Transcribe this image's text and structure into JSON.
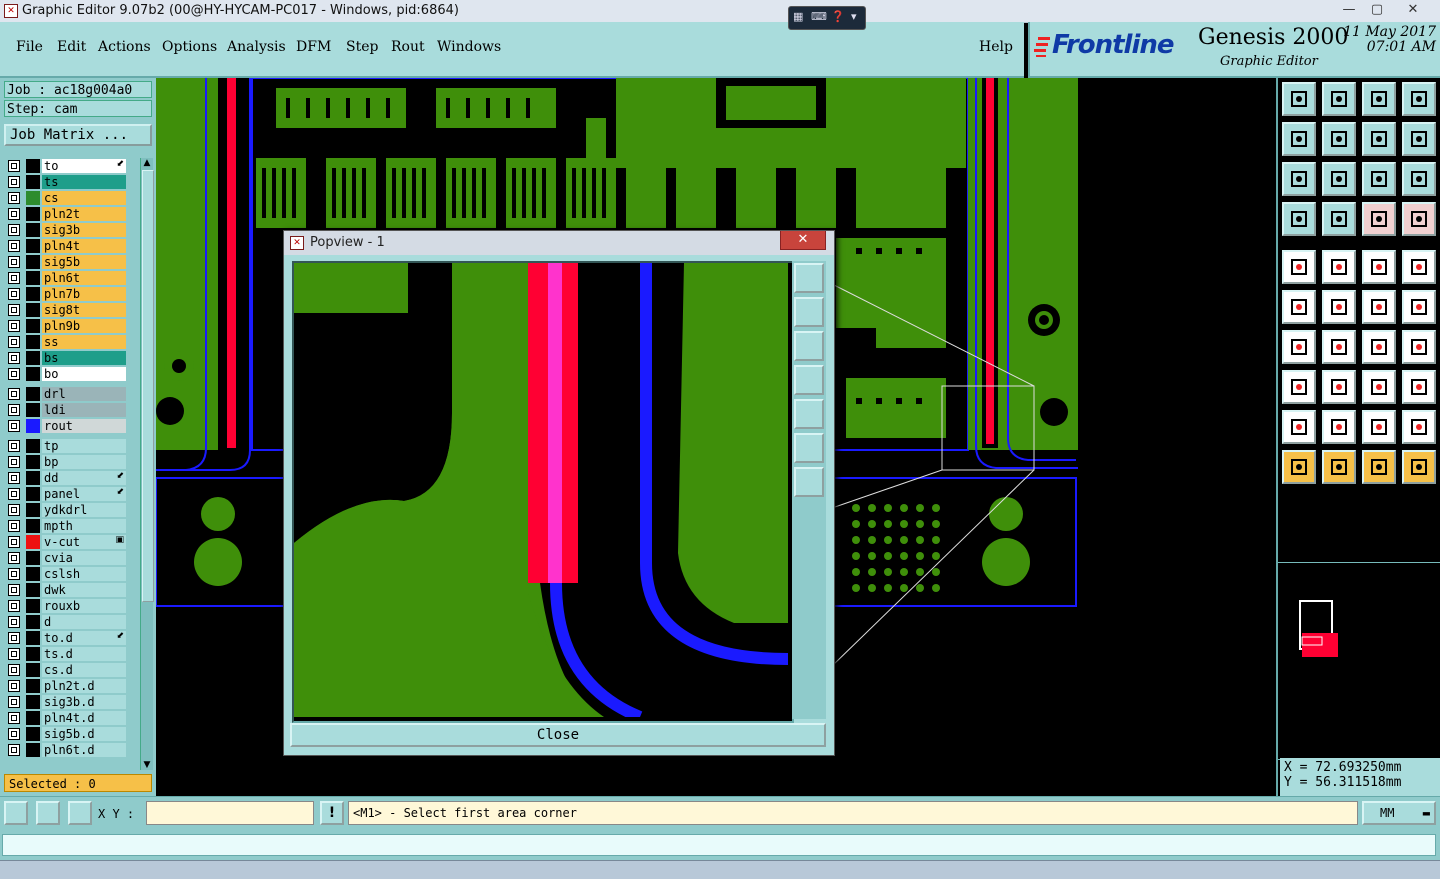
{
  "window": {
    "title": "Graphic Editor 9.07b2 (00@HY-HYCAM-PC017 - Windows, pid:6864)",
    "minimize": "—",
    "maximize": "▢",
    "close": "✕"
  },
  "menu": {
    "items": [
      "File",
      "Edit",
      "Actions",
      "Options",
      "Analysis",
      "DFM",
      "Step",
      "Rout",
      "Windows"
    ],
    "help": "Help"
  },
  "logo": {
    "brand": "Frontline",
    "product": "Genesis 2000",
    "subtitle": "Graphic Editor",
    "date": "11 May 2017",
    "time": "07:01 AM"
  },
  "job": {
    "job_label": "Job : ac18g004a0",
    "step_label": "Step: cam",
    "matrix_button": "Job Matrix ..."
  },
  "layers": [
    {
      "name": "to",
      "bg": "#ffffff",
      "swatch": "#000000",
      "mark": "⬋"
    },
    {
      "name": "ts",
      "bg": "#1e9e8a",
      "swatch": "#000000",
      "mark": ""
    },
    {
      "name": "cs",
      "bg": "#f6c048",
      "swatch": "#2d8c2d",
      "mark": ""
    },
    {
      "name": "pln2t",
      "bg": "#f6c048",
      "swatch": "#000000",
      "mark": ""
    },
    {
      "name": "sig3b",
      "bg": "#f6c048",
      "swatch": "#000000",
      "mark": ""
    },
    {
      "name": "pln4t",
      "bg": "#f6c048",
      "swatch": "#000000",
      "mark": ""
    },
    {
      "name": "sig5b",
      "bg": "#f6c048",
      "swatch": "#000000",
      "mark": ""
    },
    {
      "name": "pln6t",
      "bg": "#f6c048",
      "swatch": "#000000",
      "mark": ""
    },
    {
      "name": "pln7b",
      "bg": "#f6c048",
      "swatch": "#000000",
      "mark": ""
    },
    {
      "name": "sig8t",
      "bg": "#f6c048",
      "swatch": "#000000",
      "mark": ""
    },
    {
      "name": "pln9b",
      "bg": "#f6c048",
      "swatch": "#000000",
      "mark": ""
    },
    {
      "name": "ss",
      "bg": "#f6c048",
      "swatch": "#000000",
      "mark": ""
    },
    {
      "name": "bs",
      "bg": "#1e9e8a",
      "swatch": "#000000",
      "mark": ""
    },
    {
      "name": "bo",
      "bg": "#ffffff",
      "swatch": "#000000",
      "mark": ""
    },
    {
      "name": "drl",
      "bg": "#9ab4b8",
      "swatch": "#000000",
      "mark": ""
    },
    {
      "name": "ldi",
      "bg": "#9ab4b8",
      "swatch": "#000000",
      "mark": ""
    },
    {
      "name": "rout",
      "bg": "#d0d8d8",
      "swatch": "#1a1aff",
      "mark": ""
    },
    {
      "name": "tp",
      "bg": "#a9dcdc",
      "swatch": "#000000",
      "mark": ""
    },
    {
      "name": "bp",
      "bg": "#a9dcdc",
      "swatch": "#000000",
      "mark": ""
    },
    {
      "name": "dd",
      "bg": "#a9dcdc",
      "swatch": "#000000",
      "mark": "⬋"
    },
    {
      "name": "panel",
      "bg": "#a9dcdc",
      "swatch": "#000000",
      "mark": "⬋"
    },
    {
      "name": "ydkdrl",
      "bg": "#a9dcdc",
      "swatch": "#000000",
      "mark": ""
    },
    {
      "name": "mpth",
      "bg": "#a9dcdc",
      "swatch": "#000000",
      "mark": ""
    },
    {
      "name": "v-cut",
      "bg": "#a9dcdc",
      "swatch": "#ee1111",
      "mark": "▣"
    },
    {
      "name": "cvia",
      "bg": "#a9dcdc",
      "swatch": "#000000",
      "mark": ""
    },
    {
      "name": "cslsh",
      "bg": "#a9dcdc",
      "swatch": "#000000",
      "mark": ""
    },
    {
      "name": "dwk",
      "bg": "#a9dcdc",
      "swatch": "#000000",
      "mark": ""
    },
    {
      "name": "rouxb",
      "bg": "#a9dcdc",
      "swatch": "#000000",
      "mark": ""
    },
    {
      "name": "d",
      "bg": "#a9dcdc",
      "swatch": "#000000",
      "mark": ""
    },
    {
      "name": "to.d",
      "bg": "#a9dcdc",
      "swatch": "#000000",
      "mark": "⬋"
    },
    {
      "name": "ts.d",
      "bg": "#a9dcdc",
      "swatch": "#000000",
      "mark": ""
    },
    {
      "name": "cs.d",
      "bg": "#a9dcdc",
      "swatch": "#000000",
      "mark": ""
    },
    {
      "name": "pln2t.d",
      "bg": "#a9dcdc",
      "swatch": "#000000",
      "mark": ""
    },
    {
      "name": "sig3b.d",
      "bg": "#a9dcdc",
      "swatch": "#000000",
      "mark": ""
    },
    {
      "name": "pln4t.d",
      "bg": "#a9dcdc",
      "swatch": "#000000",
      "mark": ""
    },
    {
      "name": "sig5b.d",
      "bg": "#a9dcdc",
      "swatch": "#000000",
      "mark": ""
    },
    {
      "name": "pln6t.d",
      "bg": "#a9dcdc",
      "swatch": "#000000",
      "mark": ""
    }
  ],
  "selected": "Selected : 0",
  "coords": {
    "x": "X = 72.693250mm",
    "y": "Y = 56.311518mm"
  },
  "bottom": {
    "xy_label": "X Y :",
    "xy_value": "",
    "message": "<M1> - Select first area corner",
    "unit": "MM"
  },
  "popview": {
    "title": "Popview - 1",
    "close_label": "Close"
  },
  "colors": {
    "panel": "#a9dcdc",
    "copper": "#3f8f0a",
    "vcut": "#ff0033",
    "rout": "#1a1aff"
  }
}
